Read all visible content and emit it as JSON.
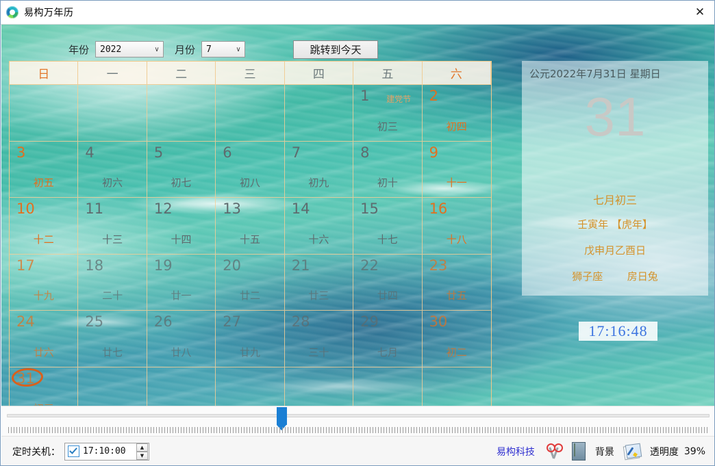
{
  "window": {
    "title": "易构万年历",
    "app_icon": "globe-recycle-icon",
    "close_label": "✕"
  },
  "toolbar": {
    "year_label": "年份",
    "year_value": "2022",
    "month_label": "月份",
    "month_value": "7",
    "today_button": "跳转到今天",
    "chevron": "∨"
  },
  "calendar": {
    "weekday_headers": [
      {
        "label": "日",
        "weekend": true
      },
      {
        "label": "一",
        "weekend": false
      },
      {
        "label": "二",
        "weekend": false
      },
      {
        "label": "三",
        "weekend": false
      },
      {
        "label": "四",
        "weekend": false
      },
      {
        "label": "五",
        "weekend": false
      },
      {
        "label": "六",
        "weekend": true
      }
    ],
    "cells": [
      {
        "day": "",
        "lunar": "",
        "fest": "",
        "empty": true
      },
      {
        "day": "",
        "lunar": "",
        "fest": "",
        "empty": true
      },
      {
        "day": "",
        "lunar": "",
        "fest": "",
        "empty": true
      },
      {
        "day": "",
        "lunar": "",
        "fest": "",
        "empty": true
      },
      {
        "day": "",
        "lunar": "",
        "fest": "",
        "empty": true
      },
      {
        "day": "1",
        "lunar": "初三",
        "fest": "建党节",
        "weekend": false
      },
      {
        "day": "2",
        "lunar": "初四",
        "fest": "",
        "weekend": true
      },
      {
        "day": "3",
        "lunar": "初五",
        "fest": "",
        "weekend": true
      },
      {
        "day": "4",
        "lunar": "初六",
        "fest": "",
        "weekend": false
      },
      {
        "day": "5",
        "lunar": "初七",
        "fest": "",
        "weekend": false
      },
      {
        "day": "6",
        "lunar": "初八",
        "fest": "",
        "weekend": false
      },
      {
        "day": "7",
        "lunar": "初九",
        "fest": "",
        "weekend": false
      },
      {
        "day": "8",
        "lunar": "初十",
        "fest": "",
        "weekend": false
      },
      {
        "day": "9",
        "lunar": "十一",
        "fest": "",
        "weekend": true
      },
      {
        "day": "10",
        "lunar": "十二",
        "fest": "",
        "weekend": true
      },
      {
        "day": "11",
        "lunar": "十三",
        "fest": "",
        "weekend": false
      },
      {
        "day": "12",
        "lunar": "十四",
        "fest": "",
        "weekend": false
      },
      {
        "day": "13",
        "lunar": "十五",
        "fest": "",
        "weekend": false
      },
      {
        "day": "14",
        "lunar": "十六",
        "fest": "",
        "weekend": false
      },
      {
        "day": "15",
        "lunar": "十七",
        "fest": "",
        "weekend": false
      },
      {
        "day": "16",
        "lunar": "十八",
        "fest": "",
        "weekend": true
      },
      {
        "day": "17",
        "lunar": "十九",
        "fest": "",
        "weekend": true
      },
      {
        "day": "18",
        "lunar": "二十",
        "fest": "",
        "weekend": false
      },
      {
        "day": "19",
        "lunar": "廿一",
        "fest": "",
        "weekend": false
      },
      {
        "day": "20",
        "lunar": "廿二",
        "fest": "",
        "weekend": false
      },
      {
        "day": "21",
        "lunar": "廿三",
        "fest": "",
        "weekend": false
      },
      {
        "day": "22",
        "lunar": "廿四",
        "fest": "",
        "weekend": false
      },
      {
        "day": "23",
        "lunar": "廿五",
        "fest": "",
        "weekend": true
      },
      {
        "day": "24",
        "lunar": "廿六",
        "fest": "",
        "weekend": true
      },
      {
        "day": "25",
        "lunar": "廿七",
        "fest": "",
        "weekend": false
      },
      {
        "day": "26",
        "lunar": "廿八",
        "fest": "",
        "weekend": false
      },
      {
        "day": "27",
        "lunar": "廿九",
        "fest": "",
        "weekend": false
      },
      {
        "day": "28",
        "lunar": "三十",
        "fest": "",
        "weekend": false
      },
      {
        "day": "29",
        "lunar": "七月",
        "fest": "",
        "weekend": false
      },
      {
        "day": "30",
        "lunar": "初二",
        "fest": "",
        "weekend": true
      },
      {
        "day": "31",
        "lunar": "初三",
        "fest": "",
        "weekend": true,
        "today": true
      },
      {
        "day": "",
        "lunar": "",
        "fest": "",
        "empty": true
      },
      {
        "day": "",
        "lunar": "",
        "fest": "",
        "empty": true
      },
      {
        "day": "",
        "lunar": "",
        "fest": "",
        "empty": true
      },
      {
        "day": "",
        "lunar": "",
        "fest": "",
        "empty": true
      },
      {
        "day": "",
        "lunar": "",
        "fest": "",
        "empty": true
      },
      {
        "day": "",
        "lunar": "",
        "fest": "",
        "empty": true
      }
    ]
  },
  "info": {
    "gregorian": "公元2022年7月31日 星期日",
    "big_day": "31",
    "lunar_date": "七月初三",
    "ganzhi_year": "壬寅年 【虎年】",
    "ganzhi_day": "戊申月乙酉日",
    "zodiac_sign": "狮子座",
    "constellation": "房日兔",
    "clock": "17:16:48"
  },
  "trackbar": {
    "thumb_position_percent": 39
  },
  "statusbar": {
    "shutdown_label": "定时关机：",
    "shutdown_time": "17:10:00",
    "shutdown_checked": true,
    "spin_up": "▲",
    "spin_down": "▼",
    "company_link": "易构科技",
    "scissors_icon": "scissors-icon",
    "calculator_icon": "calculator-icon",
    "background_label": "背景",
    "picture_icon": "picture-icon",
    "opacity_label": "透明度",
    "opacity_value": "39%"
  },
  "colors": {
    "accent_orange": "#e2701f",
    "lunar_gold": "#d4922a",
    "clock_blue": "#3c74e0",
    "link_blue": "#2f2fd0",
    "grid_border": "#f0c98a",
    "weekday_gray": "#5e6b6e"
  }
}
